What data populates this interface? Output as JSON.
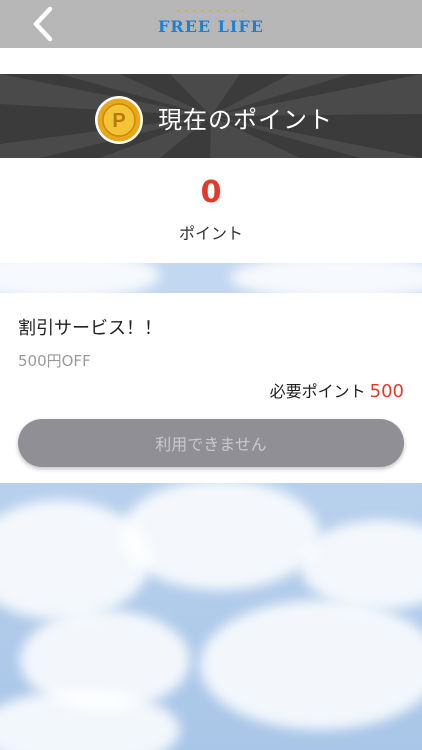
{
  "header": {
    "logo_tagline": "・・・・・・・・・",
    "logo_text": "FREE LIFE",
    "back_icon": "chevron-left-icon"
  },
  "points": {
    "title": "現在のポイント",
    "coin_letter": "P",
    "value": "0",
    "unit": "ポイント"
  },
  "service": {
    "title": "割引サービス！！",
    "description": "500円OFF",
    "required_label": "必要ポイント",
    "required_value": "500",
    "button_label": "利用できません"
  },
  "colors": {
    "accent_red": "#e53a2a",
    "logo_blue": "#1d7fd6",
    "band_gray": "#4a4a4a",
    "button_gray": "#8f8f95"
  }
}
